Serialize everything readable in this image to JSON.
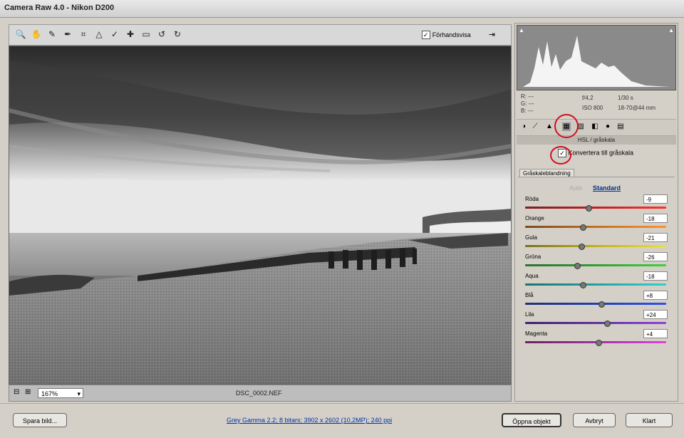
{
  "window": {
    "title": "Camera Raw 4.0 - Nikon D200"
  },
  "toolbar": {
    "tools": [
      {
        "name": "zoom-tool-icon",
        "glyph": "🔍"
      },
      {
        "name": "hand-tool-icon",
        "glyph": "✋"
      },
      {
        "name": "white-balance-tool-icon",
        "glyph": "✎"
      },
      {
        "name": "color-sampler-tool-icon",
        "glyph": "✒"
      },
      {
        "name": "crop-tool-icon",
        "glyph": "⌗"
      },
      {
        "name": "straighten-tool-icon",
        "glyph": "△"
      },
      {
        "name": "retouch-tool-icon",
        "glyph": "✓"
      },
      {
        "name": "red-eye-tool-icon",
        "glyph": "✚"
      },
      {
        "name": "preferences-icon",
        "glyph": "▭"
      },
      {
        "name": "rotate-left-icon",
        "glyph": "↺"
      },
      {
        "name": "rotate-right-icon",
        "glyph": "↻"
      }
    ],
    "preview_label": "Förhandsvisa",
    "preview_checked": true
  },
  "status": {
    "zoom": "167%",
    "filename": "DSC_0002.NEF"
  },
  "info": {
    "r": "R: ---",
    "g": "G: ---",
    "b": "B: ---",
    "aperture": "f/4,2",
    "shutter": "1/30 s",
    "iso": "ISO 800",
    "lens": "18-70@44 mm"
  },
  "panel": {
    "section_title": "HSL / gråskala",
    "grayscale_label": "Konvertera till gråskala",
    "grayscale_checked": true,
    "subtab": "Gråskaleblandning",
    "auto_label": "Auto",
    "default_label": "Standard"
  },
  "sliders": [
    {
      "label": "Röda",
      "value": "-9",
      "pos": 0.45,
      "colors": [
        "#7a2020",
        "#c02020",
        "#ff3030"
      ]
    },
    {
      "label": "Orange",
      "value": "-18",
      "pos": 0.41,
      "colors": [
        "#7a4a20",
        "#c07020",
        "#ff9030"
      ]
    },
    {
      "label": "Gula",
      "value": "-21",
      "pos": 0.4,
      "colors": [
        "#7a7020",
        "#c0b020",
        "#e8e040"
      ]
    },
    {
      "label": "Gröna",
      "value": "-26",
      "pos": 0.37,
      "colors": [
        "#307030",
        "#30a030",
        "#40d040"
      ]
    },
    {
      "label": "Aqua",
      "value": "-18",
      "pos": 0.41,
      "colors": [
        "#207070",
        "#20a0a0",
        "#30d0d0"
      ]
    },
    {
      "label": "Blå",
      "value": "+8",
      "pos": 0.54,
      "colors": [
        "#203070",
        "#2040b0",
        "#3050f0"
      ]
    },
    {
      "label": "Lila",
      "value": "+24",
      "pos": 0.58,
      "colors": [
        "#402070",
        "#6030a0",
        "#9040e0"
      ]
    },
    {
      "label": "Magenta",
      "value": "+4",
      "pos": 0.52,
      "colors": [
        "#702060",
        "#a030a0",
        "#e040e0"
      ]
    }
  ],
  "footer": {
    "save_label": "Spara bild...",
    "info_link": "Grey Gamma 2.2; 8 bitars; 3902 x 2602 (10,2MP); 240 ppi",
    "open_label": "Öppna objekt",
    "cancel_label": "Avbryt",
    "done_label": "Klart"
  }
}
